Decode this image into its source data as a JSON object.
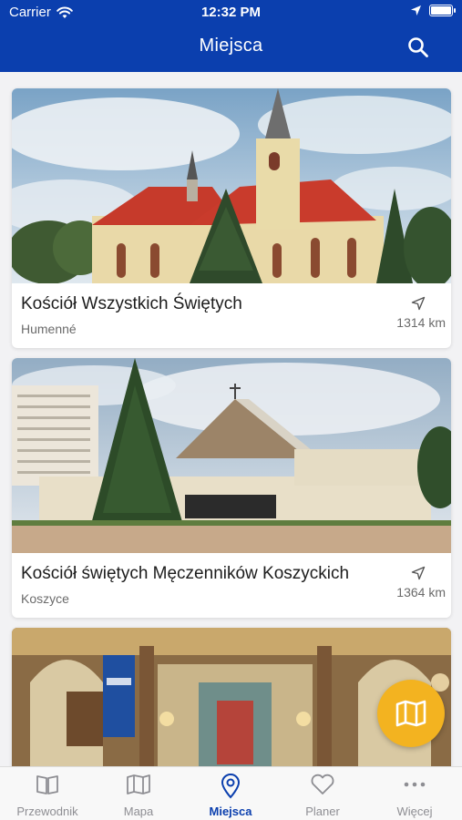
{
  "status": {
    "carrier": "Carrier",
    "time": "12:32 PM",
    "battery_level": 1.0
  },
  "header": {
    "title": "Miejsca"
  },
  "places": [
    {
      "name": "Kościół Wszystkich Świętych",
      "city": "Humenné",
      "distance": "1314 km"
    },
    {
      "name": "Kościół świętych Męczenników Koszyckich",
      "city": "Koszyce",
      "distance": "1364 km"
    }
  ],
  "tabs": [
    {
      "label": "Przewodnik"
    },
    {
      "label": "Mapa"
    },
    {
      "label": "Miejsca"
    },
    {
      "label": "Planer"
    },
    {
      "label": "Więcej"
    }
  ],
  "active_tab": "Miejsca",
  "colors": {
    "primary": "#0b3fae",
    "accent": "#f3b320",
    "inactive": "#8e8e93"
  }
}
